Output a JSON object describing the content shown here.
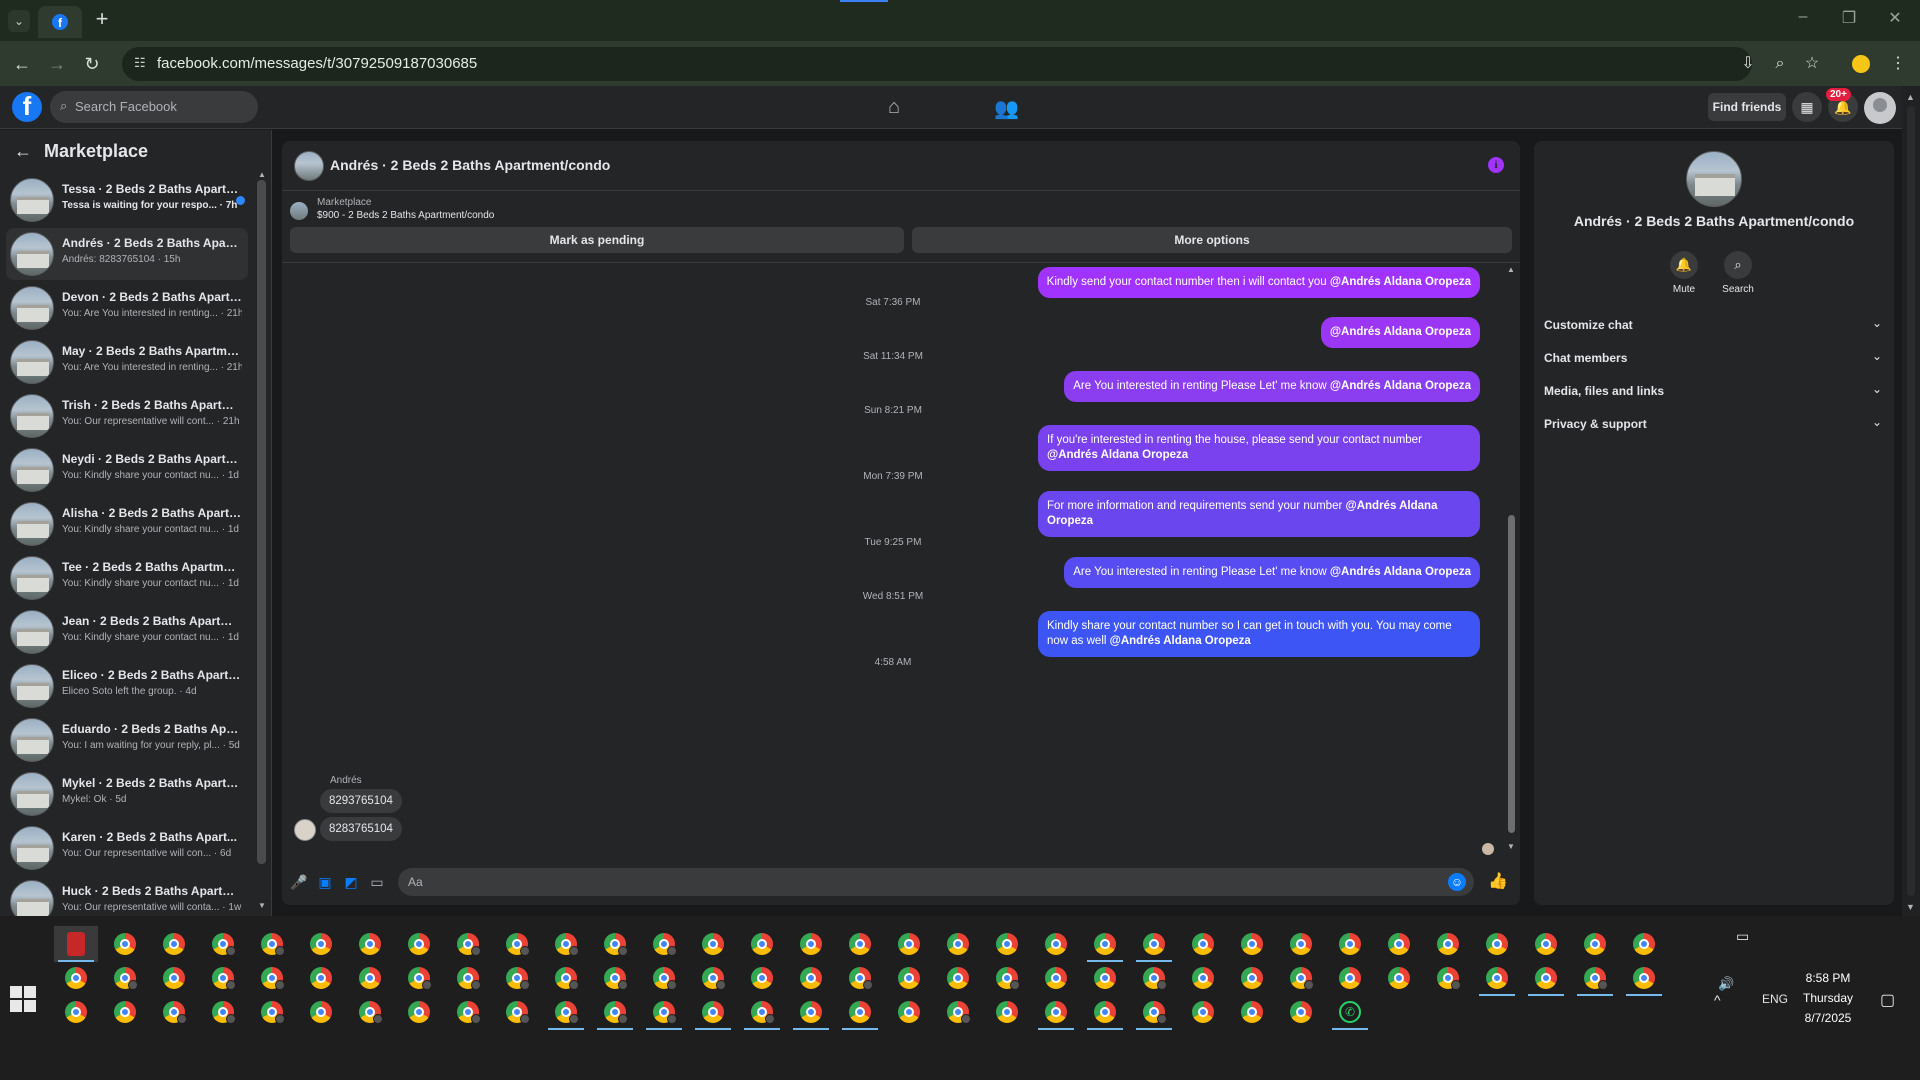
{
  "browser": {
    "url": "facebook.com/messages/t/30792509187030685",
    "tab_icon": "facebook-icon",
    "new_tab_label": "+"
  },
  "fb_header": {
    "search_placeholder": "Search Facebook",
    "find_friends": "Find friends",
    "notification_badge": "20+"
  },
  "sidebar": {
    "title": "Marketplace",
    "conversations": [
      {
        "title": "Tessa · 2 Beds 2 Baths Apartm...",
        "subtitle": "Tessa is waiting for your respo... · 7h",
        "unread": true
      },
      {
        "title": "Andrés · 2 Beds 2 Baths Apartm...",
        "subtitle": "Andrés: 8283765104 · 15h",
        "active": true
      },
      {
        "title": "Devon · 2 Beds 2 Baths Apartm...",
        "subtitle": "You: Are You interested in renting... · 21h"
      },
      {
        "title": "May · 2 Beds 2 Baths Apartmen...",
        "subtitle": "You: Are You interested in renting... · 21h"
      },
      {
        "title": "Trish · 2 Beds 2 Baths Apartmen...",
        "subtitle": "You: Our representative will cont... · 21h"
      },
      {
        "title": "Neydi · 2 Beds 2 Baths Apartme...",
        "subtitle": "You: Kindly share your contact nu... · 1d"
      },
      {
        "title": "Alisha · 2 Beds 2 Baths Apartme...",
        "subtitle": "You: Kindly share your contact nu... · 1d"
      },
      {
        "title": "Tee · 2 Beds 2 Baths Apartment...",
        "subtitle": "You: Kindly share your contact nu... · 1d"
      },
      {
        "title": "Jean · 2 Beds 2 Baths Apartmen...",
        "subtitle": "You: Kindly share your contact nu... · 1d"
      },
      {
        "title": "Eliceo · 2 Beds 2 Baths Apartme...",
        "subtitle": "Eliceo Soto left the group. · 4d"
      },
      {
        "title": "Eduardo · 2 Beds 2 Baths Apart...",
        "subtitle": "You: I am waiting for your reply, pl... · 5d"
      },
      {
        "title": "Mykel · 2 Beds 2 Baths Apartme...",
        "subtitle": "Mykel: Ok · 5d"
      },
      {
        "title": "Karen · 2 Beds 2 Baths Apart...",
        "subtitle": "You: Our representative will con... · 6d"
      },
      {
        "title": "Huck · 2 Beds 2 Baths Apartme...",
        "subtitle": "You: Our representative will conta... · 1w"
      }
    ]
  },
  "chat": {
    "title": "Andrés · 2 Beds 2 Baths Apartment/condo",
    "marketplace_label": "Marketplace",
    "listing": "$900 - 2 Beds 2 Baths Apartment/condo",
    "mark_pending": "Mark as pending",
    "more_options": "More options",
    "messages": [
      {
        "kind": "out",
        "text": "Kindly send your contact number then i will contact you ",
        "mention": "@Andrés Aldana Oropeza",
        "color": "#a033ff"
      },
      {
        "kind": "time",
        "text": "Sat 7:36 PM"
      },
      {
        "kind": "out",
        "text": "",
        "mention": "@Andrés Aldana Oropeza",
        "color": "#9b36f5"
      },
      {
        "kind": "time",
        "text": "Sat 11:34 PM"
      },
      {
        "kind": "out",
        "text": "Are You  interested in renting Please Let' me know ",
        "mention": "@Andrés Aldana Oropeza",
        "color": "#8b3df0"
      },
      {
        "kind": "time",
        "text": "Sun 8:21 PM"
      },
      {
        "kind": "out",
        "text": "If you're interested in renting the house, please send your contact number ",
        "mention": "@Andrés Aldana Oropeza",
        "color": "#7a41ef"
      },
      {
        "kind": "time",
        "text": "Mon 7:39 PM"
      },
      {
        "kind": "out",
        "text": "For more information and requirements send your number ",
        "mention": "@Andrés Aldana Oropeza",
        "color": "#6a46ef"
      },
      {
        "kind": "time",
        "text": "Tue 9:25 PM"
      },
      {
        "kind": "out",
        "text": "Are You  interested in renting Please Let' me know ",
        "mention": "@Andrés Aldana Oropeza",
        "color": "#574cf2"
      },
      {
        "kind": "time",
        "text": "Wed 8:51 PM"
      },
      {
        "kind": "out",
        "text": "Kindly share your contact number so I can get in touch with you. You may come now as well ",
        "mention": "@Andrés Aldana Oropeza",
        "color": "#3d55f5"
      },
      {
        "kind": "time",
        "text": "4:58 AM"
      }
    ],
    "sender_name": "Andrés",
    "incoming": [
      "8293765104",
      "8283765104"
    ],
    "composer_placeholder": "Aa"
  },
  "info_panel": {
    "name": "Andrés · 2 Beds 2 Baths Apartment/condo",
    "mute": "Mute",
    "search": "Search",
    "sections": [
      "Customize chat",
      "Chat members",
      "Media, files and links",
      "Privacy & support"
    ]
  },
  "taskbar": {
    "tray_lang": "ENG",
    "time": "8:58 PM",
    "day": "Thursday",
    "date": "8/7/2025"
  }
}
